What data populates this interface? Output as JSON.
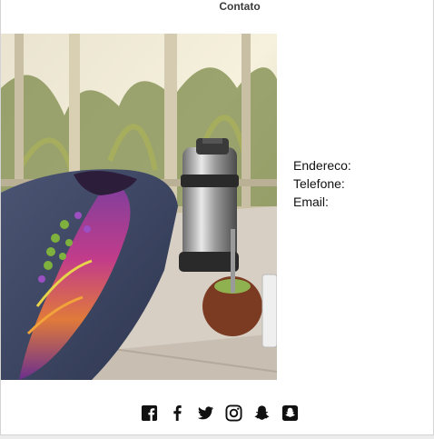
{
  "page": {
    "heading": "Contato"
  },
  "contact": {
    "address_label": "Endereco:",
    "phone_label": "Telefone:",
    "email_label": "Email:"
  },
  "social": {
    "icons": [
      "facebook-square-icon",
      "facebook-f-icon",
      "twitter-icon",
      "instagram-icon",
      "snapchat-ghost-icon",
      "snapchat-square-icon"
    ]
  },
  "colors": {
    "text": "#111111",
    "heading": "#3b3b3b",
    "border": "#d4d4d4"
  }
}
